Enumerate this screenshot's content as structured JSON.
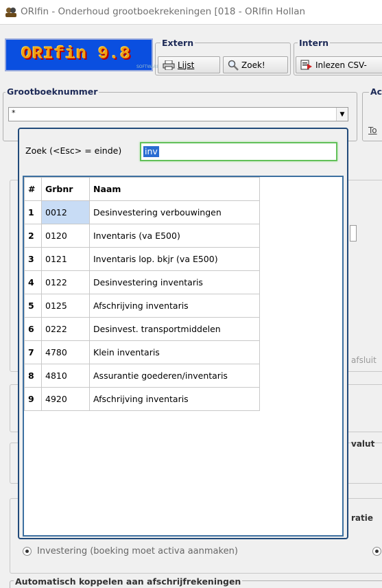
{
  "window": {
    "title": "ORIfin - Onderhoud grootboekrekeningen [018 - ORIfin Hollan",
    "icon": "app-people-icon"
  },
  "logo": {
    "text": "ORIfin 9.8",
    "sub": "SOFTWARE"
  },
  "toolbar": {
    "extern": {
      "label": "Extern",
      "buttons": [
        {
          "label": "Lijst",
          "icon": "printer-icon"
        },
        {
          "label": "Zoek!",
          "icon": "magnifier-icon"
        }
      ]
    },
    "intern": {
      "label": "Intern",
      "buttons": [
        {
          "label": "Inlezen CSV-",
          "icon": "import-icon"
        }
      ]
    },
    "right_group_label": "Ac"
  },
  "grootboeknummer": {
    "label": "Grootboeknummer",
    "combo_value": "*",
    "right_fragment": "To"
  },
  "search_popup": {
    "label": "Zoek (<Esc> = einde)",
    "query": "inv",
    "columns": [
      "#",
      "Grbnr",
      "Naam"
    ],
    "rows": [
      {
        "n": "1",
        "grbnr": "0012",
        "naam": "Desinvestering verbouwingen"
      },
      {
        "n": "2",
        "grbnr": "0120",
        "naam": "Inventaris (va E500)"
      },
      {
        "n": "3",
        "grbnr": "0121",
        "naam": "Inventaris lop. bkjr (va E500)"
      },
      {
        "n": "4",
        "grbnr": "0122",
        "naam": "Desinvestering inventaris"
      },
      {
        "n": "5",
        "grbnr": "0125",
        "naam": "Afschrijving inventaris"
      },
      {
        "n": "6",
        "grbnr": "0222",
        "naam": "Desinvest. transportmiddelen"
      },
      {
        "n": "7",
        "grbnr": "4780",
        "naam": "Klein inventaris"
      },
      {
        "n": "8",
        "grbnr": "4810",
        "naam": "Assurantie goederen/inventaris"
      },
      {
        "n": "9",
        "grbnr": "4920",
        "naam": "Afschrijving inventaris"
      }
    ]
  },
  "background_fragments": {
    "afsluit": "afsluit",
    "valut": "valut",
    "ratie": "ratie"
  },
  "radio": {
    "label": "Investering (boeking moet activa aanmaken)"
  },
  "bottom_group": {
    "label": "Automatisch koppelen aan afschrijfrekeningen"
  }
}
